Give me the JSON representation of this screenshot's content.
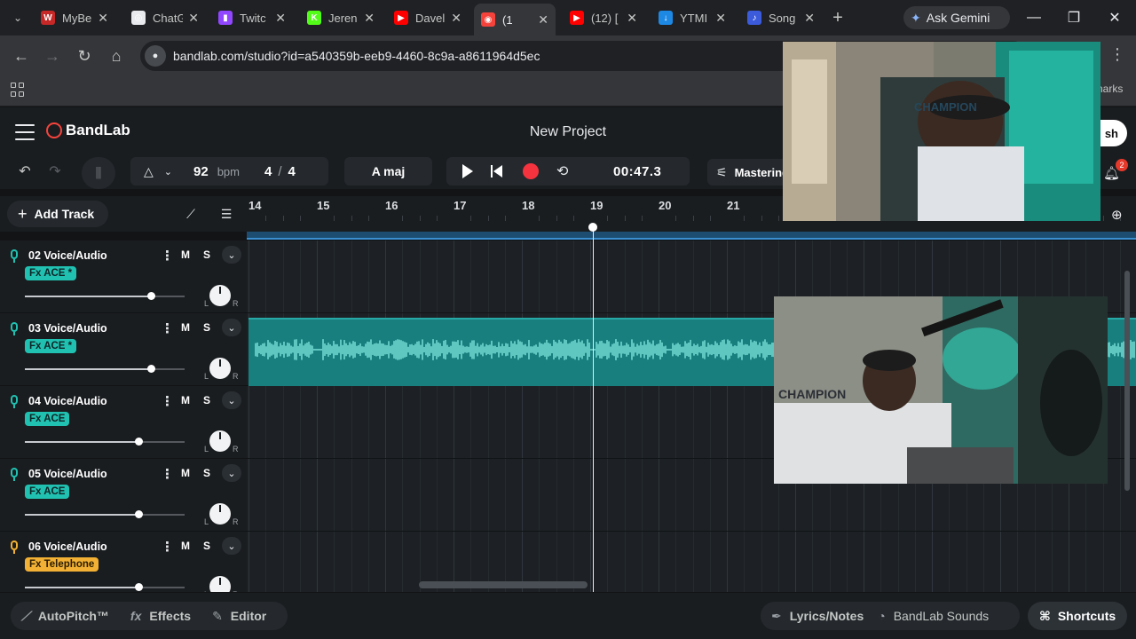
{
  "browser": {
    "tabs": [
      {
        "label": "MyBe",
        "fav_color": "#c62828",
        "fav_glyph": "W",
        "active": false
      },
      {
        "label": "ChatG",
        "fav_color": "#e8eaed",
        "fav_glyph": "◎",
        "active": false
      },
      {
        "label": "Twitc",
        "fav_color": "#9146ff",
        "fav_glyph": "▮",
        "active": false
      },
      {
        "label": "Jeren",
        "fav_color": "#53fc18",
        "fav_glyph": "K",
        "active": false
      },
      {
        "label": "Davel",
        "fav_color": "#ff0000",
        "fav_glyph": "▶",
        "active": false
      },
      {
        "label": "(1",
        "fav_color": "#f5433c",
        "fav_glyph": "◉",
        "active": true
      },
      {
        "label": "(12) [",
        "fav_color": "#ff0000",
        "fav_glyph": "▶",
        "active": false
      },
      {
        "label": "YTMI",
        "fav_color": "#1e88e5",
        "fav_glyph": "↓",
        "active": false
      },
      {
        "label": "Song",
        "fav_color": "#3b5bdb",
        "fav_glyph": "♪",
        "active": false
      }
    ],
    "gemini_label": "Ask Gemini",
    "url": "bandlab.com/studio?id=a540359b-eeb9-4460-8c9a-a8611964d5ec",
    "bookmarks_right": "narks"
  },
  "app": {
    "brand": "BandLab",
    "project_title": "New Project",
    "publish_label": "sh",
    "bpm": "92",
    "bpm_unit": "bpm",
    "time_sig_num": "4",
    "time_sig_sep": "/",
    "time_sig_den": "4",
    "key": "A maj",
    "time": "00:47.3",
    "mastering_label": "Mastering",
    "notifications": "2",
    "add_track_label": "Add Track"
  },
  "ruler": {
    "bars": [
      "14",
      "15",
      "16",
      "17",
      "18",
      "19",
      "20",
      "21"
    ]
  },
  "tracks": [
    {
      "name": "02  Voice/Audio",
      "fx": "Fx ACE *",
      "fx_type": "ace",
      "volume": 0.79,
      "mic_color": "#21c1b1",
      "has_region": false
    },
    {
      "name": "03  Voice/Audio",
      "fx": "Fx ACE *",
      "fx_type": "ace",
      "volume": 0.79,
      "mic_color": "#21c1b1",
      "has_region": true
    },
    {
      "name": "04  Voice/Audio",
      "fx": "Fx ACE",
      "fx_type": "ace",
      "volume": 0.71,
      "mic_color": "#21c1b1",
      "has_region": false
    },
    {
      "name": "05  Voice/Audio",
      "fx": "Fx ACE",
      "fx_type": "ace",
      "volume": 0.71,
      "mic_color": "#21c1b1",
      "has_region": false
    },
    {
      "name": "06  Voice/Audio",
      "fx": "Fx Telephone",
      "fx_type": "tel",
      "volume": 0.71,
      "mic_color": "#f2b134",
      "has_region": false
    }
  ],
  "track_controls": {
    "mute": "M",
    "solo": "S",
    "pan_left": "L",
    "pan_right": "R"
  },
  "bottom": {
    "autopitch": "AutoPitch™",
    "effects": "Effects",
    "editor": "Editor",
    "lyrics": "Lyrics/Notes",
    "sounds": "BandLab Sounds",
    "shortcuts": "Shortcuts"
  },
  "webcam_text": "CHAMPION"
}
